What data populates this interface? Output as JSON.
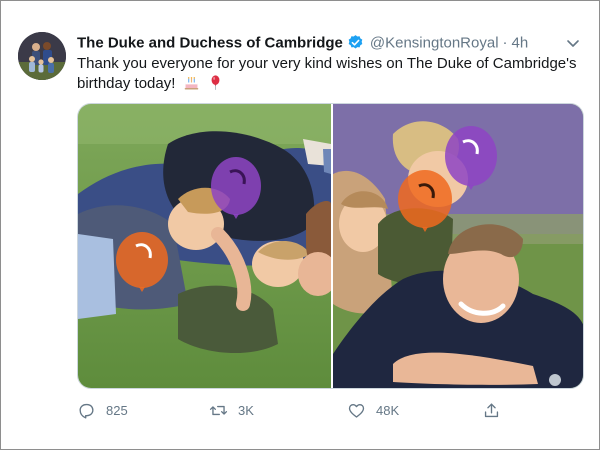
{
  "tweet": {
    "display_name": "The Duke and Duchess of Cambridge",
    "handle": "@KensingtonRoyal",
    "separator": "·",
    "timestamp": "4h",
    "verified": true,
    "text": "Thank you everyone for your very kind wishes on The Duke of Cambridge's birthday today!",
    "emojis": [
      "birthday-cake-emoji",
      "balloon-emoji"
    ]
  },
  "media": {
    "photos": [
      {
        "name": "photo-left",
        "overlay_balloons": [
          "purple-balloon-icon",
          "orange-balloon-icon"
        ]
      },
      {
        "name": "photo-right",
        "overlay_balloons": [
          "purple-balloon-icon",
          "orange-balloon-icon"
        ]
      }
    ]
  },
  "actions": {
    "reply_count": "825",
    "retweet_count": "3K",
    "like_count": "48K",
    "share_count": ""
  },
  "colors": {
    "text": "#14171a",
    "muted": "#657786",
    "verified": "#1da1f2",
    "border": "#ccd6dd",
    "balloon_purple": "#8e44c4",
    "balloon_orange": "#f06a1e"
  }
}
